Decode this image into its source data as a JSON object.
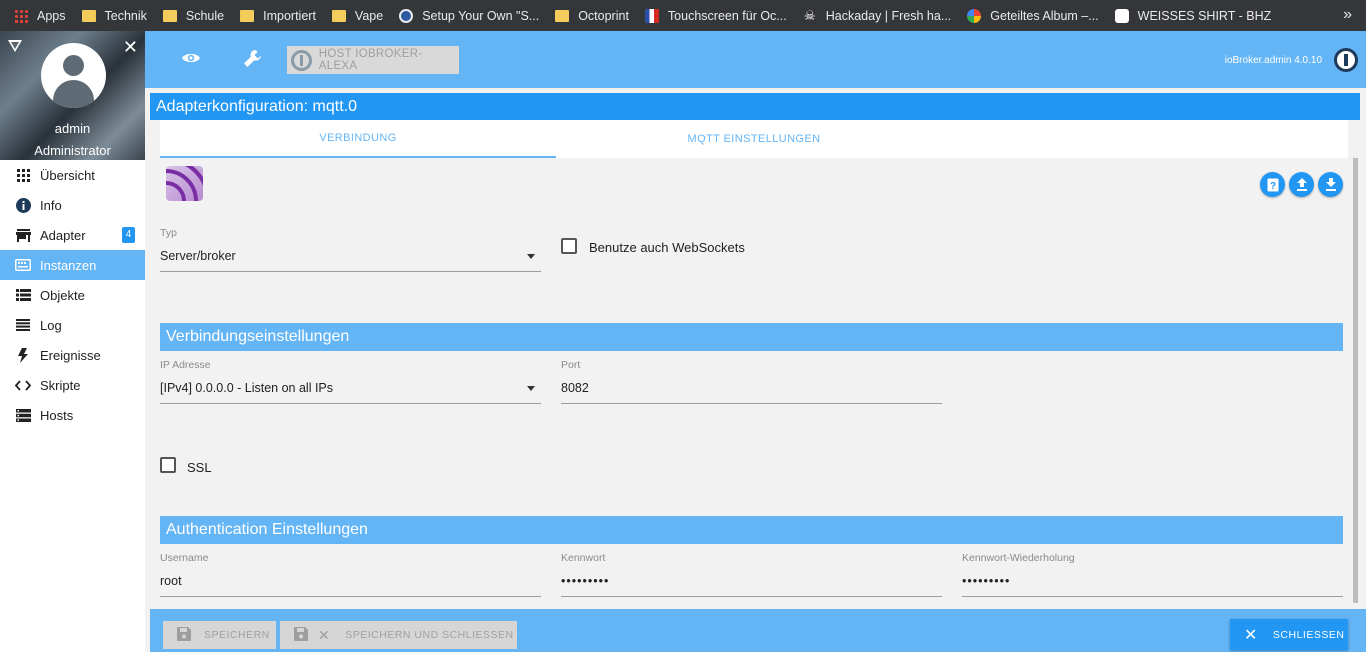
{
  "bookmarks": [
    {
      "label": "Apps",
      "icon": "apps-grid-icon"
    },
    {
      "label": "Technik",
      "icon": "folder-icon"
    },
    {
      "label": "Schule",
      "icon": "folder-icon"
    },
    {
      "label": "Importiert",
      "icon": "folder-icon"
    },
    {
      "label": "Vape",
      "icon": "folder-icon"
    },
    {
      "label": "Setup Your Own \"S...",
      "icon": "iobroker-icon"
    },
    {
      "label": "Octoprint",
      "icon": "folder-icon"
    },
    {
      "label": "Touchscreen für Oc...",
      "icon": "flag-icon"
    },
    {
      "label": "Hackaday | Fresh ha...",
      "icon": "skull-icon"
    },
    {
      "label": "Geteiltes Album –...",
      "icon": "pinwheel-icon"
    },
    {
      "label": "WEISSES SHIRT - BHZ",
      "icon": "shirt-icon"
    }
  ],
  "sidebar": {
    "user_name": "admin",
    "user_role": "Administrator",
    "items": [
      {
        "label": "Übersicht",
        "icon": "grid-icon",
        "active": false
      },
      {
        "label": "Info",
        "icon": "info-icon",
        "active": false
      },
      {
        "label": "Adapter",
        "icon": "store-icon",
        "active": false,
        "badge": "4"
      },
      {
        "label": "Instanzen",
        "icon": "instances-icon",
        "active": true
      },
      {
        "label": "Objekte",
        "icon": "list-icon",
        "active": false
      },
      {
        "label": "Log",
        "icon": "log-icon",
        "active": false
      },
      {
        "label": "Ereignisse",
        "icon": "lightning-icon",
        "active": false
      },
      {
        "label": "Skripte",
        "icon": "code-icon",
        "active": false
      },
      {
        "label": "Hosts",
        "icon": "hosts-icon",
        "active": false
      }
    ]
  },
  "topbar": {
    "host_label": "HOST IOBROKER-ALEXA",
    "version": "ioBroker.admin 4.0.10"
  },
  "page": {
    "title": "Adapterkonfiguration: mqtt.0",
    "tabs": [
      {
        "label": "VERBINDUNG",
        "active": true
      },
      {
        "label": "MQTT EINSTELLUNGEN",
        "active": false
      }
    ]
  },
  "form": {
    "typ_label": "Typ",
    "typ_value": "Server/broker",
    "websockets_label": "Benutze auch WebSockets",
    "websockets_checked": false,
    "section_connection": "Verbindungseinstellungen",
    "ip_label": "IP Adresse",
    "ip_value": "[IPv4] 0.0.0.0 - Listen on all IPs",
    "port_label": "Port",
    "port_value": "8082",
    "ssl_label": "SSL",
    "ssl_checked": false,
    "section_auth": "Authentication Einstellungen",
    "username_label": "Username",
    "username_value": "root",
    "password_label": "Kennwort",
    "password_value": "•••••••••",
    "password_repeat_label": "Kennwort-Wiederholung",
    "password_repeat_value": "•••••••••"
  },
  "footer": {
    "save_label": "SPEICHERN",
    "save_close_label": "SPEICHERN UND SCHLIESSEN",
    "close_label": "SCHLIESSEN"
  },
  "colors": {
    "primary": "#2196f3",
    "primary_light": "#64b5f6"
  }
}
